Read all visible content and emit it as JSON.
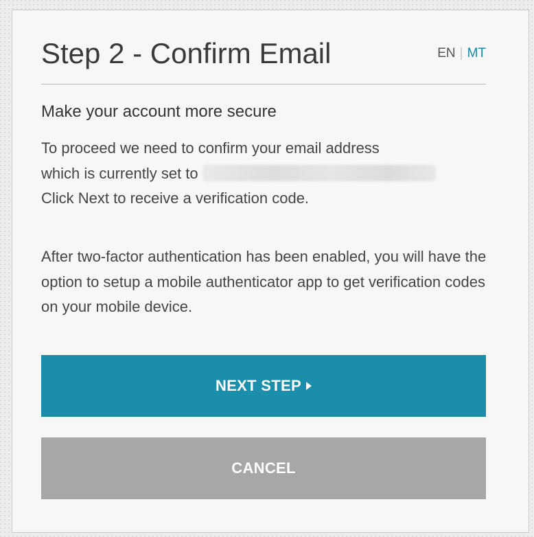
{
  "dialog": {
    "title": "Step 2 - Confirm Email",
    "languages": [
      "EN",
      "MT"
    ],
    "language_separator": "|",
    "subtitle": "Make your account more secure",
    "paragraph1_line1": "To proceed we need to confirm your email address",
    "paragraph1_line2": "which is currently set to",
    "paragraph1_line3": "Click Next to receive a verification code.",
    "paragraph2": "After two-factor authentication has been enabled, you will have the option to setup a mobile authenticator app to get verification codes on your mobile device.",
    "next_button_label": "NEXT STEP",
    "cancel_button_label": "CANCEL"
  },
  "colors": {
    "primary_button": "#1a8eab",
    "cancel_button": "#a7a7a7",
    "link": "#1a8aa8",
    "heading_text": "#3a3a3a"
  }
}
